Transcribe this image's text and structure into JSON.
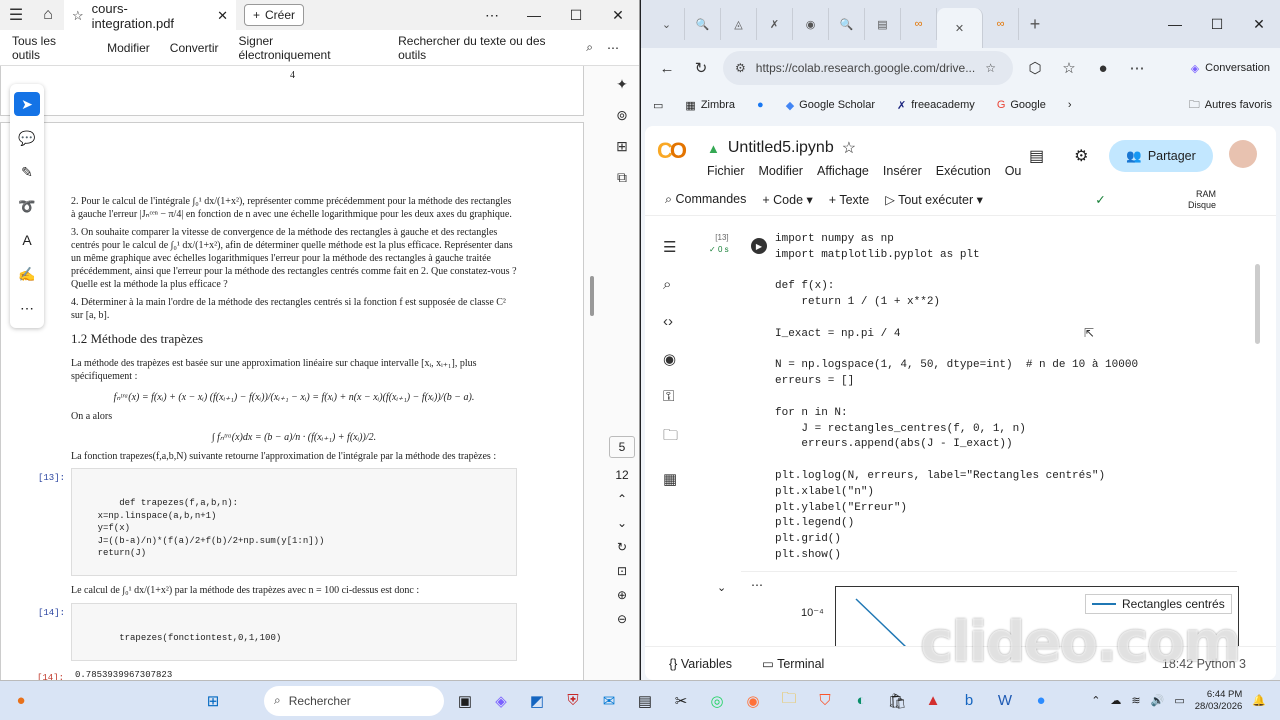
{
  "pdf": {
    "tab_title": "cours-integration.pdf",
    "create_label": "Créer",
    "menu": [
      "Tous les outils",
      "Modifier",
      "Convertir",
      "Signer électroniquement",
      "Rechercher du texte ou des outils"
    ],
    "page_number_top": "4",
    "item2": "2. Pour le calcul de l'intégrale ∫₀¹ dx/(1+x²), représenter comme précédemment pour la méthode des rectangles à gauche l'erreur |Jₙᶜᵉⁿ − π/4| en fonction de n avec une échelle logarithmique pour les deux axes du graphique.",
    "item3": "3. On souhaite comparer la vitesse de convergence de la méthode des rectangles à gauche et des rectangles centrés pour le calcul de ∫₀¹ dx/(1+x²), afin de déterminer quelle méthode est la plus efficace. Représenter dans un même graphique avec échelles logarithmiques l'erreur pour la méthode des rectangles à gauche traitée précédemment, ainsi que l'erreur pour la méthode des rectangles centrés comme fait en 2. Que constatez-vous ? Quelle est la méthode la plus efficace ?",
    "item4": "4. Déterminer à la main l'ordre de la méthode des rectangles centrés si la fonction f est supposée de classe C² sur [a, b].",
    "section": "1.2   Méthode des trapèzes",
    "para1": "La méthode des trapèzes est basée sur une approximation linéaire sur chaque intervalle [xᵢ, xᵢ₊₁], plus spécifiquement :",
    "formula1": "fₙᵗʳᵃ(x) = f(xᵢ) + (x − xᵢ) (f(xᵢ₊₁) − f(xᵢ))/(xᵢ₊₁ − xᵢ) = f(xᵢ) + n(x − xᵢ)(f(xᵢ₊₁) − f(xᵢ))/(b − a).",
    "on_a_alors": "On a alors",
    "formula2": "∫ fₙᵗʳᵃ(x)dx = (b − a)/n · (f(xᵢ₊₁) + f(xᵢ))/2.",
    "para2": "La fonction trapezes(f,a,b,N) suivante retourne l'approximation de l'intégrale par la méthode des trapèzes :",
    "cell13_label": "[13]:",
    "cell13_code": "def trapezes(f,a,b,n):\n    x=np.linspace(a,b,n+1)\n    y=f(x)\n    J=((b-a)/n)*(f(a)/2+f(b)/2+np.sum(y[1:n]))\n    return(J)",
    "para3": "Le calcul de ∫₀¹ dx/(1+x²) par la méthode des trapèzes avec n = 100 ci-dessus est donc :",
    "cell14_label": "[14]:",
    "cell14_code": "trapezes(fonctiontest,0,1,100)",
    "out14_label": "[14]:",
    "out14_value": "0.7853939967307823",
    "page_current": "5",
    "page_total": "12"
  },
  "browser": {
    "url": "https://colab.research.google.com/drive...",
    "conversation": "Conversation",
    "bookmarks": [
      "Zimbra",
      "Google Scholar",
      "freeacademy",
      "Google"
    ],
    "other_favs": "Autres favoris"
  },
  "colab": {
    "notebook_title": "Untitled5.ipynb",
    "menu": [
      "Fichier",
      "Modifier",
      "Affichage",
      "Insérer",
      "Exécution",
      "Ou"
    ],
    "share": "Partager",
    "toolbar": {
      "commands": "Commandes",
      "code": "+ Code",
      "text": "+ Texte",
      "run_all": "Tout exécuter",
      "ram": "RAM",
      "disk": "Disque"
    },
    "exec_count": "[13]",
    "exec_time": "0 s",
    "code": "import numpy as np\nimport matplotlib.pyplot as plt\n\ndef f(x):\n    return 1 / (1 + x**2)\n\nI_exact = np.pi / 4\n\nN = np.logspace(1, 4, 50, dtype=int)  # n de 10 à 10000\nerreurs = []\n\nfor n in N:\n    J = rectangles_centres(f, 0, 1, n)\n    erreurs.append(abs(J - I_exact))\n\nplt.loglog(N, erreurs, label=\"Rectangles centrés\")\nplt.xlabel(\"n\")\nplt.ylabel(\"Erreur\")\nplt.legend()\nplt.grid()\nplt.show()",
    "legend": "Rectangles centrés",
    "ytick": "10⁻⁴",
    "status_variables": "Variables",
    "status_terminal": "Terminal",
    "status_right": "18:42   Python 3"
  },
  "taskbar": {
    "search": "Rechercher",
    "time": "6:44 PM",
    "date": "28/03/2026"
  },
  "watermark": "clideo.com"
}
